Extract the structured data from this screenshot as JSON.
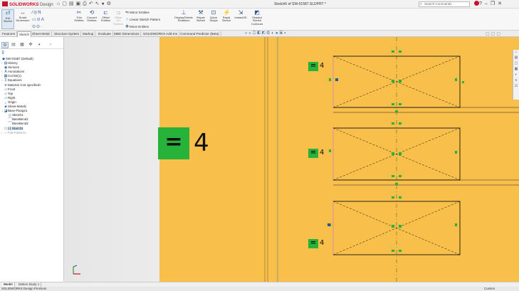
{
  "app": {
    "logo_brand": "SOLIDWORKS",
    "logo_sub": "Design",
    "document_title": "Sketch6 of SW-01587.SLDPRT *",
    "search_placeholder": "Search Commands"
  },
  "ribbon": {
    "exit_sketch": "Exit Sketch",
    "smart_dimension": "Smart Dimension",
    "trim_entities": "Trim Entities",
    "convert_entities": "Convert Entities",
    "offset_entities": "Offset Entities",
    "offset_on_surface": "Offset On Surface",
    "mirror_entities": "Mirror Entities",
    "linear_sketch_pattern": "Linear Sketch Pattern",
    "move_entities": "Move Entities",
    "display_delete_relations": "Display/Delete Relations",
    "repair_sketch": "Repair Sketch",
    "quick_snaps": "Quick Snaps",
    "rapid_sketch": "Rapid Sketch",
    "instant2d": "Instant2D",
    "shaded_sketch_contours": "Shaded Sketch Contours"
  },
  "command_tabs": [
    {
      "label": "Features"
    },
    {
      "label": "Sketch"
    },
    {
      "label": "Sheet Metal"
    },
    {
      "label": "Structure System"
    },
    {
      "label": "Markup"
    },
    {
      "label": "Evaluate"
    },
    {
      "label": "MBD Dimensions"
    },
    {
      "label": "SOLIDWORKS Add-Ins"
    },
    {
      "label": "Command Predictor (Beta)"
    }
  ],
  "feature_tree": [
    {
      "label": "SW-01587 (Default)",
      "icon": "part-icon"
    },
    {
      "label": "History",
      "icon": "history-icon"
    },
    {
      "label": "Sensors",
      "icon": "sensor-icon"
    },
    {
      "label": "Annotations",
      "icon": "annotation-icon"
    },
    {
      "label": "Cut list(1)",
      "icon": "cutlist-icon"
    },
    {
      "label": "Equations",
      "icon": "equation-icon"
    },
    {
      "label": "Material <not specified>",
      "icon": "material-icon"
    },
    {
      "label": "Front",
      "icon": "plane-icon"
    },
    {
      "label": "Top",
      "icon": "plane-icon"
    },
    {
      "label": "Right",
      "icon": "plane-icon"
    },
    {
      "label": "Origin",
      "icon": "origin-icon"
    },
    {
      "label": "Sheet-Metal1",
      "icon": "sheetmetal-icon"
    },
    {
      "label": "Base-Flange1",
      "icon": "flange-icon"
    },
    {
      "label": "Sketch1",
      "icon": "sketch-icon"
    },
    {
      "label": "BaseBend1",
      "icon": "bend-icon"
    },
    {
      "label": "BaseBend2",
      "icon": "bend-icon"
    },
    {
      "label": "(-) Sketch3",
      "icon": "sketch-icon"
    },
    {
      "label": "Flat-Pattern1",
      "icon": "flatpattern-icon"
    }
  ],
  "relations": {
    "big_value": "4",
    "small_values": [
      "4",
      "4",
      "4"
    ],
    "equal_glyph": "="
  },
  "bottom_tabs": [
    {
      "label": "Model"
    },
    {
      "label": "Motion Study 1"
    }
  ],
  "status": {
    "left": "SOLIDWORKS Design Premium",
    "right": "Custom"
  },
  "colors": {
    "sheet": "#f8c04a",
    "relation_green": "#27b23a",
    "sketch_line": "#111111",
    "brand": "#c8102e"
  }
}
